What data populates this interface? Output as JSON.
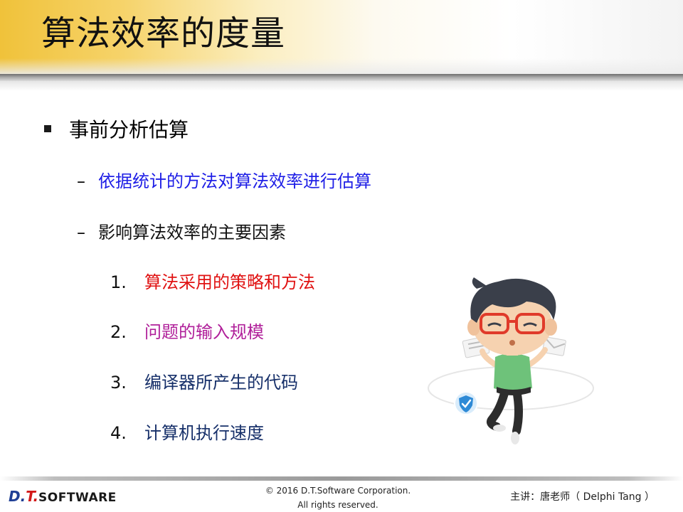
{
  "title": "算法效率的度量",
  "main": {
    "level1": "事前分析估算",
    "level2": [
      {
        "dash": "–",
        "text": "依据统计的方法对算法效率进行估算",
        "color": "#1e1ee6"
      },
      {
        "dash": "–",
        "text": "影响算法效率的主要因素",
        "color": "#111111"
      }
    ],
    "factors": [
      {
        "num": "1.",
        "text": "算法采用的策略和方法",
        "color": "#e01212"
      },
      {
        "num": "2.",
        "text": "问题的输入规模",
        "color": "#b0209a"
      },
      {
        "num": "3.",
        "text": "编译器所产生的代码",
        "color": "#17306a"
      },
      {
        "num": "4.",
        "text": "计算机执行速度",
        "color": "#17306a"
      }
    ]
  },
  "footer": {
    "logo_d": "D.",
    "logo_t": "T.",
    "logo_software": "SOFTWARE",
    "copyright_line1": "© 2016 D.T.Software Corporation.",
    "copyright_line2": "All rights reserved.",
    "speaker": "主讲：唐老师（ Delphi Tang ）"
  },
  "illustration": {
    "icon": "cartoon-boy-with-glasses",
    "colors": {
      "shirt": "#6ec27a",
      "hair": "#3a3f4a",
      "glasses": "#e03a2a",
      "skin": "#f6d2b0",
      "shield": "#2e8ad6"
    }
  }
}
